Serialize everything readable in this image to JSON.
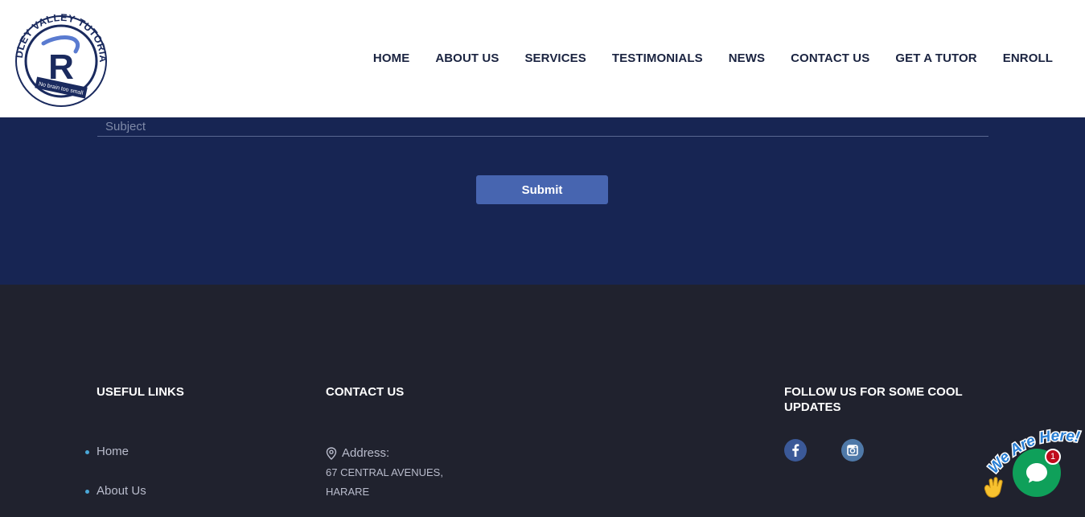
{
  "brand": {
    "logo_top_text": "RIDLEY VALLEY TUTORIAL",
    "logo_monogram": "R",
    "logo_tagline": "No brain too small"
  },
  "nav": {
    "items": [
      "HOME",
      "ABOUT US",
      "SERVICES",
      "TESTIMONIALS",
      "NEWS",
      "CONTACT US",
      "GET A TUTOR",
      "ENROLL"
    ]
  },
  "form": {
    "subject_placeholder": "Subject",
    "submit_label": "Submit"
  },
  "footer": {
    "useful_links_title": "USEFUL LINKS",
    "links": [
      "Home",
      "About Us"
    ],
    "contact_title": "CONTACT US",
    "address_label": "Address:",
    "address_lines": [
      "67 CENTRAL AVENUES,",
      "HARARE"
    ],
    "follow_title_lines": [
      "FOLLOW US FOR SOME COOL",
      "UPDATES"
    ],
    "social_icons": [
      "facebook-icon",
      "instagram-icon"
    ]
  },
  "chat": {
    "tagline": "We Are Here!",
    "badge_count": "1"
  },
  "colors": {
    "form_band": "#172553",
    "footer_bg": "#20222e",
    "submit": "#4765b0",
    "chat_green": "#0fa05a",
    "badge_red": "#c00b1c"
  }
}
